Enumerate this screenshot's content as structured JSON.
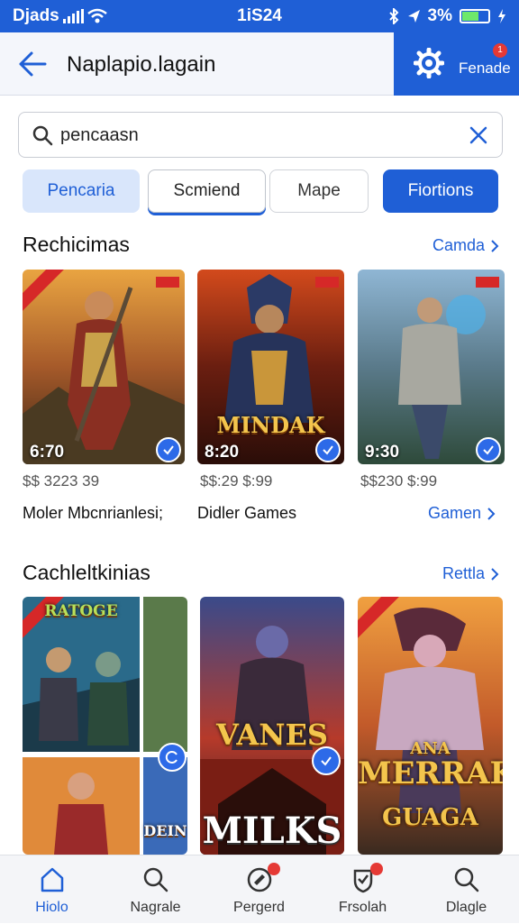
{
  "status": {
    "carrier": "Djads",
    "time": "1iS24",
    "battery": "3%"
  },
  "header": {
    "title": "Naplapio.lagain",
    "settings_label": "Fenade",
    "notif_count": "1"
  },
  "search": {
    "value": "pencaasn"
  },
  "chips": [
    "Pencaria",
    "Scmiend",
    "Mape",
    "Fiortions"
  ],
  "sections": [
    {
      "title": "Rechicimas",
      "link": "Camda"
    },
    {
      "title": "Cachleltkinias",
      "link": "Rettla"
    }
  ],
  "cards": [
    {
      "time": "6:70",
      "price": "$$ 3223 39",
      "name": "Moler Mbcnrianlesi;",
      "logo": ""
    },
    {
      "time": "8:20",
      "price": "$$:29 $:99",
      "name": "Didler Games",
      "logo": "MINDAK"
    },
    {
      "time": "9:30",
      "price": "$$230 $:99",
      "name": "Gamen",
      "logo": ""
    }
  ],
  "row2_logos": [
    "RATOGE",
    "VANES",
    "MILKS",
    "MERRAK",
    "GUAGA",
    "DEIN",
    "ANA"
  ],
  "nav": [
    "Hiolo",
    "Nagrale",
    "Pergerd",
    "Frsolah",
    "Dlagle"
  ],
  "colors": {
    "brand": "#1f5fd6",
    "accent_red": "#e53935"
  }
}
